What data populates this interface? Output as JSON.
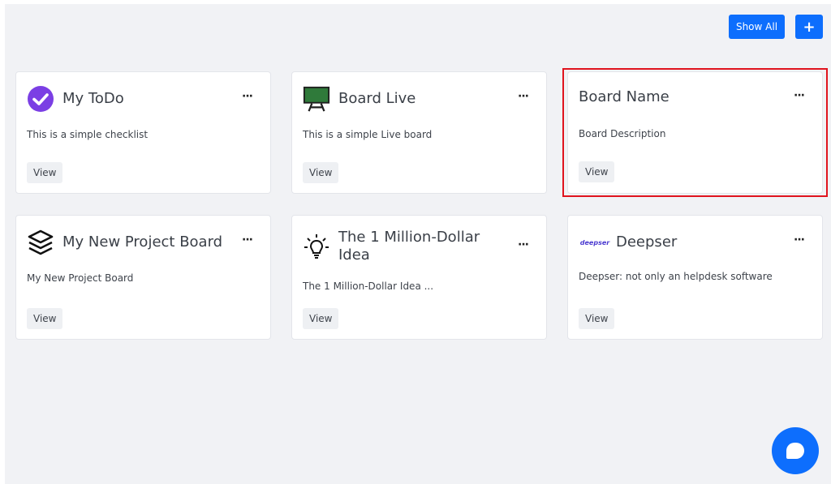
{
  "toolbar": {
    "show_all_label": "Show All",
    "add_label": "+"
  },
  "boards": [
    {
      "title": "My ToDo",
      "description": "This is a simple checklist",
      "view_label": "View",
      "menu_label": "···",
      "icon": "check-circle-icon"
    },
    {
      "title": "Board Live",
      "description": "This is a simple Live board",
      "view_label": "View",
      "menu_label": "···",
      "icon": "chalkboard-icon"
    },
    {
      "title": "Board Name",
      "description": "Board Description",
      "view_label": "View",
      "menu_label": "···",
      "icon": ""
    },
    {
      "title": "My New Project Board",
      "description": "My New Project Board",
      "view_label": "View",
      "menu_label": "···",
      "icon": "layers-icon"
    },
    {
      "title_line1": "The 1 Million-Dollar",
      "title_line2": "Idea",
      "description": "The 1 Million-Dollar Idea ...",
      "view_label": "View",
      "menu_label": "···",
      "icon": "lightbulb-icon"
    },
    {
      "title": "Deepser",
      "description": "Deepser: not only an helpdesk software",
      "view_label": "View",
      "menu_label": "···",
      "icon": "deepser-logo",
      "logo_text": "deepser"
    }
  ],
  "colors": {
    "accent": "#0d6efd",
    "highlight": "#e0141e",
    "todo_icon": "#7b3fe4",
    "board_green": "#2f7a3a"
  }
}
